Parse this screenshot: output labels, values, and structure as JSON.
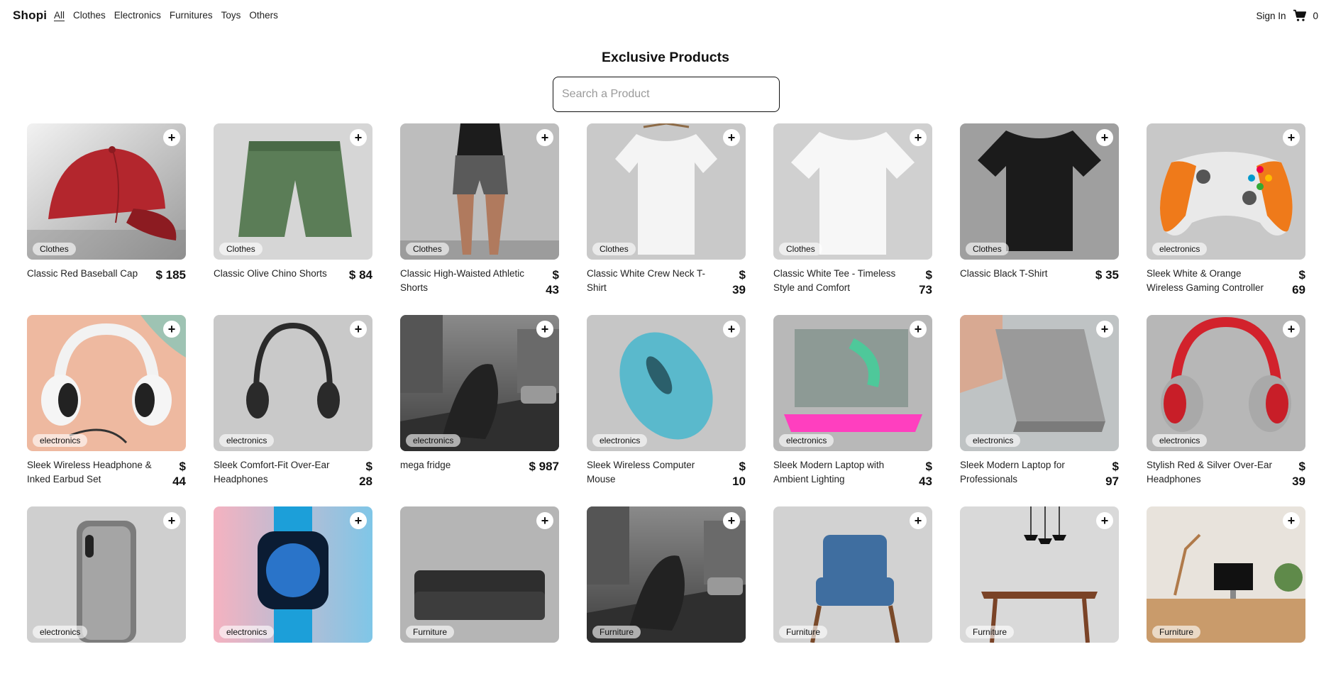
{
  "nav": {
    "brand": "Shopi",
    "links": [
      "All",
      "Clothes",
      "Electronics",
      "Furnitures",
      "Toys",
      "Others"
    ],
    "active": "All",
    "sign_in": "Sign In",
    "cart_count": "0"
  },
  "title": "Exclusive Products",
  "search": {
    "placeholder": "Search a Product",
    "value": ""
  },
  "products": [
    {
      "name": "Classic Red Baseball Cap",
      "price": "$ 185",
      "category": "Clothes",
      "art": "cap"
    },
    {
      "name": "Classic Olive Chino Shorts",
      "price": "$ 84",
      "category": "Clothes",
      "art": "shorts"
    },
    {
      "name": "Classic High-Waisted Athletic Shorts",
      "price": "$ 43",
      "category": "Clothes",
      "art": "athletic"
    },
    {
      "name": "Classic White Crew Neck T-Shirt",
      "price": "$ 39",
      "category": "Clothes",
      "art": "tee-white"
    },
    {
      "name": "Classic White Tee - Timeless Style and Comfort",
      "price": "$ 73",
      "category": "Clothes",
      "art": "tee-white2"
    },
    {
      "name": "Classic Black T-Shirt",
      "price": "$ 35",
      "category": "Clothes",
      "art": "tee-black"
    },
    {
      "name": "Sleek White & Orange Wireless Gaming Controller",
      "price": "$ 69",
      "category": "electronics",
      "art": "controller"
    },
    {
      "name": "Sleek Wireless Headphone & Inked Earbud Set",
      "price": "$ 44",
      "category": "electronics",
      "art": "headphones-white"
    },
    {
      "name": "Sleek Comfort-Fit Over-Ear Headphones",
      "price": "$ 28",
      "category": "electronics",
      "art": "headphones-black"
    },
    {
      "name": "mega fridge",
      "price": "$ 987",
      "category": "electronics",
      "art": "street"
    },
    {
      "name": "Sleek Wireless Computer Mouse",
      "price": "$ 10",
      "category": "electronics",
      "art": "mouse"
    },
    {
      "name": "Sleek Modern Laptop with Ambient Lighting",
      "price": "$ 43",
      "category": "electronics",
      "art": "laptop-glow"
    },
    {
      "name": "Sleek Modern Laptop for Professionals",
      "price": "$ 97",
      "category": "electronics",
      "art": "laptop-grey"
    },
    {
      "name": "Stylish Red & Silver Over-Ear Headphones",
      "price": "$ 39",
      "category": "electronics",
      "art": "headphones-red"
    },
    {
      "name": "",
      "price": "",
      "category": "electronics",
      "art": "phone"
    },
    {
      "name": "",
      "price": "",
      "category": "electronics",
      "art": "watch"
    },
    {
      "name": "",
      "price": "",
      "category": "Furniture",
      "art": "sofa"
    },
    {
      "name": "",
      "price": "",
      "category": "Furniture",
      "art": "street"
    },
    {
      "name": "",
      "price": "",
      "category": "Furniture",
      "art": "chair"
    },
    {
      "name": "",
      "price": "",
      "category": "Furniture",
      "art": "table"
    },
    {
      "name": "",
      "price": "",
      "category": "Furniture",
      "art": "desk"
    }
  ],
  "colors": {
    "accent": "#111111",
    "badge_bg": "rgba(255,255,255,0.62)"
  }
}
